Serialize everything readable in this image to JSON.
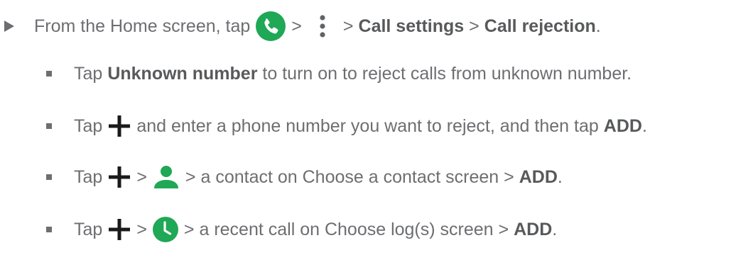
{
  "main_step": {
    "before_icon": "From the Home screen, tap",
    "gt1": ">",
    "gt2": ">",
    "call_settings": "Call settings",
    "gt3": ">",
    "call_rejection": "Call rejection",
    "end": ".",
    "icons": [
      "phone-app-icon",
      "more-options-icon"
    ]
  },
  "substeps": [
    {
      "tap": "Tap",
      "bold1": "Unknown number",
      "rest": "to turn on to reject calls from unknown number."
    },
    {
      "tap": "Tap",
      "rest": "and enter a phone number you want to reject, and then tap",
      "bold_end": "ADD",
      "end": ".",
      "icons": [
        "plus-icon"
      ]
    },
    {
      "tap": "Tap",
      "gt1": ">",
      "rest": "> a contact on Choose a contact screen >",
      "bold_end": "ADD",
      "end": ".",
      "icons": [
        "plus-icon",
        "contact-person-icon"
      ]
    },
    {
      "tap": "Tap",
      "gt1": ">",
      "rest": "> a recent call on Choose log(s) screen >",
      "bold_end": "ADD",
      "end": ".",
      "icons": [
        "plus-icon",
        "recent-calls-icon"
      ]
    }
  ],
  "colors": {
    "text": "#6d6e71",
    "bold_text": "#58595b",
    "green": "#1fa855"
  }
}
